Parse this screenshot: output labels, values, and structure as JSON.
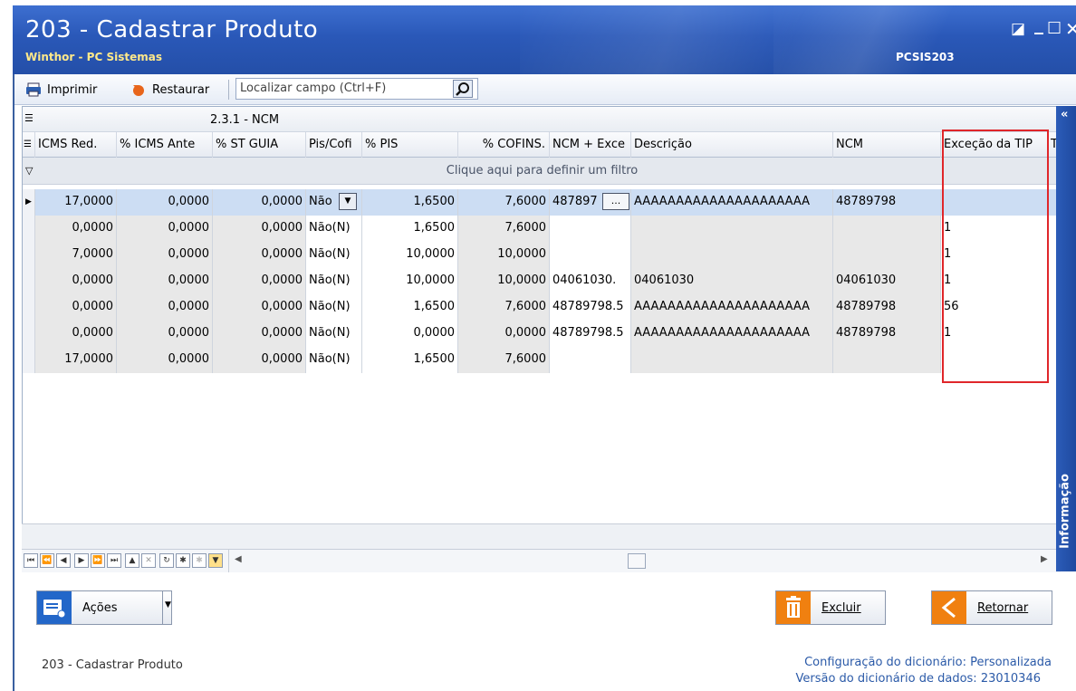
{
  "window": {
    "title": "203 - Cadastrar  Produto",
    "subtitle": "Winthor - PC Sistemas",
    "screen_code": "PCSIS203",
    "controls": [
      "◪",
      "_",
      "☐",
      "✕"
    ]
  },
  "toolbar": {
    "print_label": "Imprimir",
    "restore_label": "Restaurar",
    "search_placeholder": "Localizar campo (Ctrl+F)"
  },
  "grid": {
    "band_label": "2.3.1 - NCM",
    "filter_hint": "Clique aqui para definir um filtro",
    "columns": [
      "ICMS Red.",
      "% ICMS Ante",
      "% ST GUIA",
      "Pis/Cofi",
      "% PIS",
      "% COFINS.",
      "NCM + Exce",
      "Descrição",
      "NCM",
      "Exceção da TIP",
      "T"
    ],
    "rows": [
      {
        "icms_red": "17,0000",
        "icms_ante": "0,0000",
        "st_guia": "0,0000",
        "pis_cofins": "Não",
        "pis": "1,6500",
        "cofins": "7,6000",
        "ncm_exc": "487897",
        "descricao": "AAAAAAAAAAAAAAAAAAAAA",
        "ncm": "48789798",
        "excecao": "",
        "selected": true
      },
      {
        "icms_red": "0,0000",
        "icms_ante": "0,0000",
        "st_guia": "0,0000",
        "pis_cofins": "Não(N)",
        "pis": "1,6500",
        "cofins": "7,6000",
        "ncm_exc": "",
        "descricao": "",
        "ncm": "",
        "excecao": "1",
        "selected": false
      },
      {
        "icms_red": "7,0000",
        "icms_ante": "0,0000",
        "st_guia": "0,0000",
        "pis_cofins": "Não(N)",
        "pis": "10,0000",
        "cofins": "10,0000",
        "ncm_exc": "",
        "descricao": "",
        "ncm": "",
        "excecao": "1",
        "selected": false
      },
      {
        "icms_red": "0,0000",
        "icms_ante": "0,0000",
        "st_guia": "0,0000",
        "pis_cofins": "Não(N)",
        "pis": "10,0000",
        "cofins": "10,0000",
        "ncm_exc": "04061030.",
        "descricao": "04061030",
        "ncm": "04061030",
        "excecao": "1",
        "selected": false
      },
      {
        "icms_red": "0,0000",
        "icms_ante": "0,0000",
        "st_guia": "0,0000",
        "pis_cofins": "Não(N)",
        "pis": "1,6500",
        "cofins": "7,6000",
        "ncm_exc": "48789798.5",
        "descricao": "AAAAAAAAAAAAAAAAAAAAA",
        "ncm": "48789798",
        "excecao": "56",
        "selected": false
      },
      {
        "icms_red": "0,0000",
        "icms_ante": "0,0000",
        "st_guia": "0,0000",
        "pis_cofins": "Não(N)",
        "pis": "0,0000",
        "cofins": "0,0000",
        "ncm_exc": "48789798.5",
        "descricao": "AAAAAAAAAAAAAAAAAAAAA",
        "ncm": "48789798",
        "excecao": "1",
        "selected": false
      },
      {
        "icms_red": "17,0000",
        "icms_ante": "0,0000",
        "st_guia": "0,0000",
        "pis_cofins": "Não(N)",
        "pis": "1,6500",
        "cofins": "7,6000",
        "ncm_exc": "",
        "descricao": "",
        "ncm": "",
        "excecao": "",
        "selected": false
      }
    ]
  },
  "side_panel": {
    "label": "Informação"
  },
  "actions": {
    "acoes_label": "Ações",
    "excluir_label": "Excluir",
    "retornar_label": "Retornar"
  },
  "status": {
    "screen_name": "203 - Cadastrar  Produto",
    "config_label": "Configuração do dicionário:",
    "config_value": "Personalizada",
    "version_label": "Versão do dicionário de dados:",
    "version_value": "23010346"
  },
  "colors": {
    "title_bar": "#2a58b8",
    "highlight_box": "#e0262a",
    "selected_row": "#ccddf3"
  }
}
